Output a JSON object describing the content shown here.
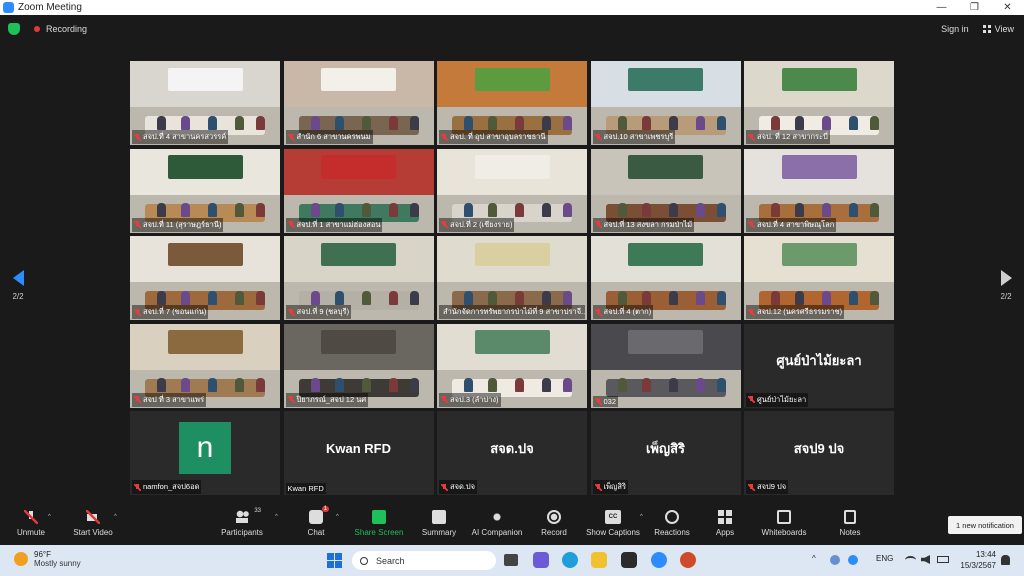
{
  "window": {
    "title": "Zoom Meeting",
    "controls": [
      "—",
      "❐",
      "✕"
    ]
  },
  "status": {
    "recording_label": "Recording",
    "sign_in": "Sign in",
    "view": "View"
  },
  "pager": {
    "left": "2/2",
    "right": "2/2"
  },
  "tiles": [
    {
      "name": "สจป.ที่ 4 สาขานครสวรรค์",
      "wall": "#d9d6cf",
      "table": "#e8e4dc",
      "banner": "#f4f4f4"
    },
    {
      "name": "สำนัก 6 สาขานครพนม",
      "wall": "#c9b8a8",
      "table": "#7a6650",
      "banner": "#f3efe9"
    },
    {
      "name": "สจป. ที่ อุป สาขาอุบลราชธานี",
      "wall": "#c47a3b",
      "table": "#9a7040",
      "banner": "#5c9c3f"
    },
    {
      "name": "สจป.10 สาขาเพชรบุรี",
      "wall": "#d7dfe4",
      "table": "#b89b78",
      "banner": "#3c7a6a"
    },
    {
      "name": "สจป. ที่ 12 สาขากระบี่",
      "wall": "#dcd8cc",
      "table": "#f0ece4",
      "banner": "#4b8a4a"
    },
    {
      "name": "สจป.ที่ 11 (สุราษฎร์ธานี)",
      "wall": "#e9e6de",
      "table": "#b88a55",
      "banner": "#2f5a3a"
    },
    {
      "name": "สจป.ที่ 1 สาขาแม่ฮ่องสอน",
      "wall": "#b63c36",
      "table": "#3f7a60",
      "banner": "#c52d2d"
    },
    {
      "name": "สจป.ที่ 2 (เชียงราย)",
      "wall": "#e8e4da",
      "table": "#d8d4cc",
      "banner": "#f0ece6"
    },
    {
      "name": "สจป.ที่ 13 สงขลา กรมป่าไม้",
      "wall": "#c9c4ba",
      "table": "#7a4f35",
      "banner": "#3a5a42"
    },
    {
      "name": "สจป.ที่ 4 สาขาพิษณุโลก",
      "wall": "#e5e2dd",
      "table": "#a86e3c",
      "banner": "#8b6fa8"
    },
    {
      "name": "สจป.ที่ 7 (ขอนแก่น)",
      "wall": "#e7e3da",
      "table": "#9c6a3c",
      "banner": "#7a5a3a"
    },
    {
      "name": "สจป.ที่ 9 (ชลบุรี)",
      "wall": "#d8d4c8",
      "table": "#b5b0a5",
      "banner": "#3f7050"
    },
    {
      "name": "สำนักจัดการทรัพยากรป่าไม้ที่ 9 สาขาปราจี...",
      "wall": "#dfdccf",
      "table": "#8a6a4a",
      "banner": "#d9cfa0"
    },
    {
      "name": "สจป.ที่ 4 (ตาก)",
      "wall": "#e3e0d8",
      "table": "#9a5f35",
      "banner": "#3e7a58"
    },
    {
      "name": "สจป.12 (นครศรีธรรมราช)",
      "wall": "#e5e0d2",
      "table": "#b0662e",
      "banner": "#6c9a6a"
    },
    {
      "name": "สจป ที่ 3 สาขาแพร่",
      "wall": "#d9d0c0",
      "table": "#a07a52",
      "banner": "#8c6a3f"
    },
    {
      "name": "ปิยาภรณ์_สจป 12 นศ",
      "wall": "#6a6660",
      "table": "#3e3a36",
      "banner": "#504a44"
    },
    {
      "name": "สจป.3 (ลำปาง)",
      "wall": "#e1ddd3",
      "table": "#efebe3",
      "banner": "#5a8a6a"
    },
    {
      "name": "032",
      "wall": "#4a4a4e",
      "table": "#5a5a5e",
      "banner": "#6a6a6e"
    },
    {
      "name": "ศูนย์ป่าไม้ยะลา",
      "plain_text": "ศูนย์ป่าไม้ยะลา"
    },
    {
      "name": "namfon_สจป6อด",
      "avatar": "n"
    },
    {
      "name": "Kwan RFD",
      "plain_text": "Kwan RFD"
    },
    {
      "name": "สจด.ปจ",
      "plain_text": "สจด.ปจ"
    },
    {
      "name": "เพ็ญสิริ",
      "plain_text": "เพ็ญสิริ"
    },
    {
      "name": "สจป9 ปจ",
      "plain_text": "สจป9 ปจ"
    }
  ],
  "toolbar": {
    "unmute": "Unmute",
    "start_video": "Start Video",
    "participants": "Participants",
    "participants_count": "33",
    "chat": "Chat",
    "chat_badge": "1",
    "share": "Share Screen",
    "summary": "Summary",
    "ai": "AI Companion",
    "record": "Record",
    "captions": "Show Captions",
    "reactions": "Reactions",
    "apps": "Apps",
    "whiteboards": "Whiteboards",
    "notes": "Notes",
    "caption_icon_text": "CC"
  },
  "notification": "1 new notification",
  "taskbar": {
    "weather_temp": "96°F",
    "weather_desc": "Mostly sunny",
    "search_placeholder": "Search",
    "lang": "ENG",
    "time": "13:44",
    "date": "15/3/2567",
    "tray_caret": "^"
  },
  "colors": {
    "accent": "#2d8cff",
    "share": "#1fbf59",
    "danger": "#e03a3a",
    "bg": "#1a1a1a"
  }
}
